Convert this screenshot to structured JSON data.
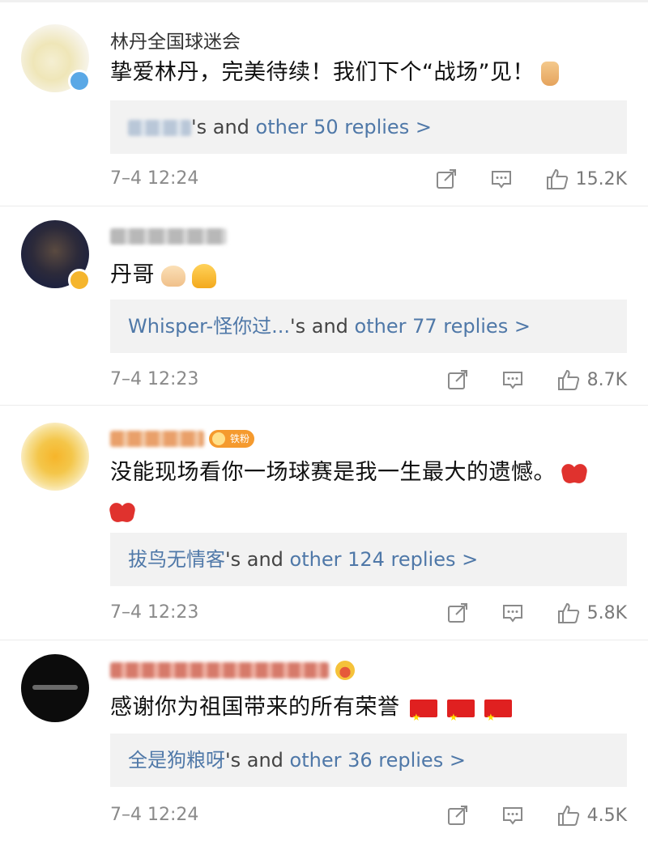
{
  "comments": [
    {
      "username": "林丹全国球迷会",
      "text": "挚爱林丹，完美待续！我们下个“战场”见！",
      "reply_suffix": "'s and ",
      "reply_link": "other 50 replies >",
      "time": "7–4 12:24",
      "likes": "15.2K"
    },
    {
      "text": "丹哥",
      "reply_user": "Whisper-怪你过...",
      "reply_suffix": "'s and ",
      "reply_link": "other 77 replies >",
      "time": "7–4 12:23",
      "likes": "8.7K"
    },
    {
      "badge": "铁粉",
      "text_line1": "没能现场看你一场球赛是我一生最大的遗憾。",
      "reply_user": "拔鸟无情客",
      "reply_suffix": "'s and ",
      "reply_link": "other 124 replies >",
      "time": "7–4 12:23",
      "likes": "5.8K"
    },
    {
      "text": "感谢你为祖国带来的所有荣誉",
      "reply_user": "全是狗粮呀",
      "reply_suffix": "'s and ",
      "reply_link": "other 36 replies >",
      "time": "7–4 12:24",
      "likes": "4.5K"
    }
  ],
  "icons": {
    "emoji_1": "thumbs-up-emoji",
    "emoji_2": [
      "clapping-hands-emoji",
      "folded-hands-emoji"
    ],
    "emoji_3": "broken-heart-emoji",
    "emoji_4": "china-flag-emoji",
    "repost": "repost-icon",
    "comment": "comment-icon",
    "like": "like-icon"
  },
  "colors": {
    "link_blue": "#4f78a8",
    "reply_bg": "#f2f2f2",
    "meta_gray": "#8a8a8a",
    "badge_orange": "#f59a2e"
  }
}
